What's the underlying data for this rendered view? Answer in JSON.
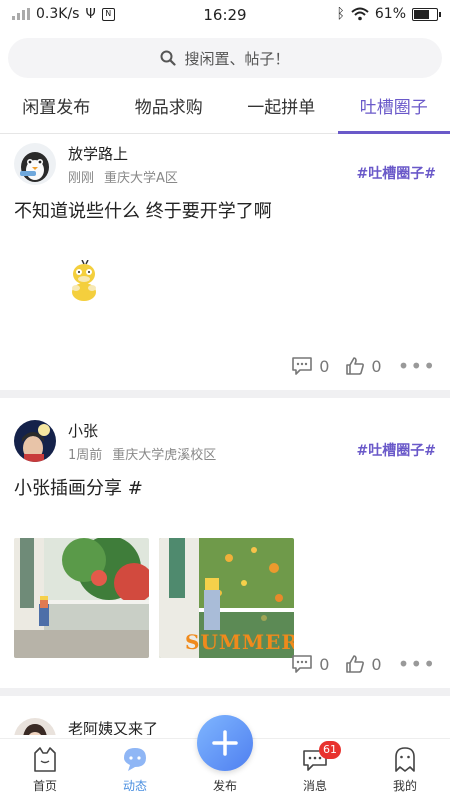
{
  "status_bar": {
    "speed": "0.3K/s",
    "time": "16:29",
    "battery": "61%",
    "battery_level": 0.61
  },
  "search": {
    "placeholder": "搜闲置、帖子！"
  },
  "tabs": [
    {
      "label": "闲置发布"
    },
    {
      "label": "物品求购"
    },
    {
      "label": "一起拼单"
    },
    {
      "label": "吐槽圈子",
      "active": true
    }
  ],
  "posts": [
    {
      "username": "放学路上",
      "time": "刚刚",
      "location": "重庆大学A区",
      "tag": "#吐槽圈子#",
      "text": "不知道说些什么 终于要开学了啊",
      "comments": "0",
      "likes": "0"
    },
    {
      "username": "小张",
      "time": "1周前",
      "location": "重庆大学虎溪校区",
      "tag": "#吐槽圈子#",
      "text": "小张插画分享 #",
      "image_text": "SUMMER",
      "comments": "0",
      "likes": "0"
    },
    {
      "username": "老阿姨又来了"
    }
  ],
  "bottom_nav": [
    {
      "label": "首页"
    },
    {
      "label": "动态",
      "active": true
    },
    {
      "label": "发布"
    },
    {
      "label": "消息",
      "badge": "61"
    },
    {
      "label": "我的"
    }
  ],
  "colors": {
    "accent": "#6a59c9",
    "nav_active": "#4a8fe0",
    "badge": "#e8322e"
  }
}
